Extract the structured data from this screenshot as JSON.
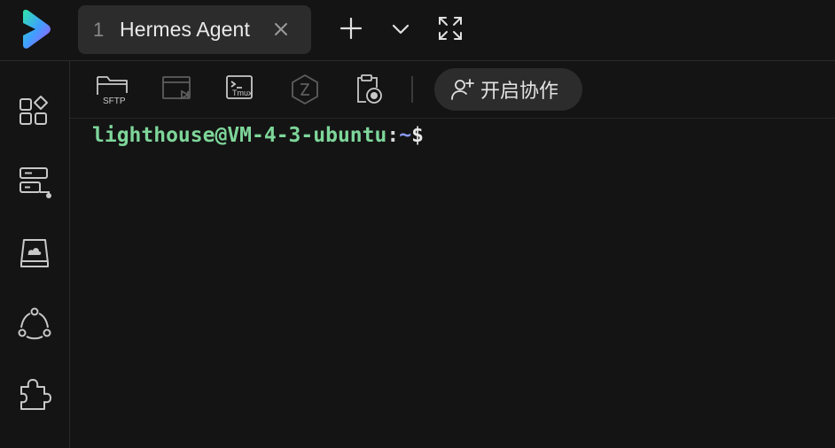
{
  "tab": {
    "number": "1",
    "title": "Hermes Agent"
  },
  "top_actions": {
    "close_tab": "close-icon",
    "new_tab": "plus-icon",
    "tab_menu": "chevron-down-icon",
    "fullscreen": "fullscreen-icon"
  },
  "sidebar": {
    "items": [
      {
        "icon": "apps-grid-icon"
      },
      {
        "icon": "server-list-icon"
      },
      {
        "icon": "cloud-drive-icon"
      },
      {
        "icon": "network-nodes-icon"
      },
      {
        "icon": "plugin-puzzle-icon"
      }
    ]
  },
  "toolbar": {
    "sftp_label": "SFTP",
    "tmux_label": "Tmux",
    "collab_label": "开启协作"
  },
  "terminal": {
    "user_host": "lighthouse@VM-4-3-ubuntu",
    "colon": ":",
    "path": "~",
    "dollar": "$"
  },
  "colors": {
    "background": "#141414",
    "tab_bg": "#2c2c2c",
    "prompt_user": "#7ed69a",
    "prompt_path": "#8b9bff"
  }
}
